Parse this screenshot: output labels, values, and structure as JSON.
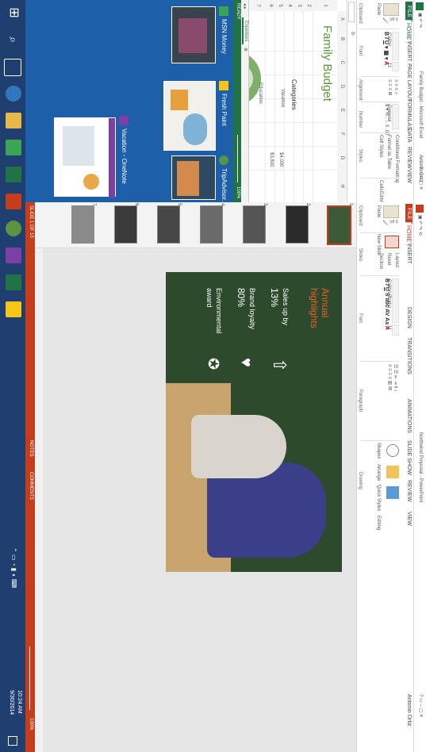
{
  "excel": {
    "title": "Family Budget - Microsoft Excel",
    "tabs": [
      "FILE",
      "HOME",
      "INSERT",
      "PAGE LAYOUT",
      "FORMULAS",
      "DATA",
      "REVIEW",
      "VIEW"
    ],
    "user": "Antonio Ortiz",
    "ribbon": {
      "paste": "Paste",
      "font_name": "Calibri",
      "font_size": "11",
      "number_format": "General",
      "conditional_formatting": "Conditional Formatting",
      "format_as_table": "Format as Table",
      "cell_styles": "Cell Styles",
      "cells": "Cells",
      "editing": "Editing",
      "groups": [
        "Clipboard",
        "Font",
        "Alignment",
        "Number",
        "Styles"
      ]
    },
    "formula_bar": {
      "fx": "fx"
    },
    "columns": [
      "A",
      "B",
      "C",
      "D",
      "E",
      "F",
      "G",
      "H"
    ],
    "rows": [
      "1",
      "2",
      "3",
      "4",
      "5",
      "6",
      "7"
    ],
    "cells": {
      "title": "Family Budget",
      "categories": "Categories",
      "vacation": "Vacation",
      "value1": "$4,000",
      "value2": "$3,800",
      "education": "Education"
    },
    "sheet_tab": "Expenses",
    "status": "READY",
    "zoom": "100%"
  },
  "powerpoint": {
    "title": "Northwind Proposal - PowerPoint",
    "tabs": [
      "FILE",
      "HOME",
      "INSERT",
      "DESIGN",
      "TRANSITIONS",
      "ANIMATIONS",
      "SLIDE SHOW",
      "REVIEW",
      "VIEW"
    ],
    "user": "Antonio Ortiz",
    "ribbon": {
      "paste": "Paste",
      "new_slide": "New Slide",
      "layout": "Layout",
      "reset": "Reset",
      "section": "Section",
      "font_name": "Calibri (Body)",
      "font_size": "11",
      "shapes": "Shapes",
      "arrange": "Arrange",
      "quick_styles": "Quick Styles",
      "editing": "Editing",
      "groups": [
        "Clipboard",
        "Slides",
        "Font",
        "Paragraph",
        "Drawing"
      ]
    },
    "slide_numbers": [
      "1",
      "2",
      "3",
      "4",
      "5",
      "6",
      "7"
    ],
    "slide": {
      "heading_line1": "Annual",
      "heading_line2": "highlights",
      "stat1_label": "Sales up by",
      "stat1_value": "13%",
      "stat2_label": "Brand loyalty",
      "stat2_value": "80%",
      "stat3_label_1": "Environmental",
      "stat3_label_2": "award",
      "icon1": "dollar-icon",
      "icon2": "heart-icon",
      "icon3": "award-icon"
    },
    "status": {
      "slide_of": "SLIDE 1 OF 10",
      "notes": "NOTES",
      "comments": "COMMENTS",
      "zoom": "100%"
    }
  },
  "start": {
    "tiles": [
      {
        "label": "MSN Money",
        "icon": "money-icon"
      },
      {
        "label": "Fresh Paint",
        "icon": "paint-icon"
      },
      {
        "label": "TripAdvisor...",
        "icon": "tripadvisor-icon"
      },
      {
        "label": "Vacation - OneNote",
        "icon": "onenote-icon"
      }
    ]
  },
  "taskbar": {
    "time": "10:24 AM",
    "date": "9/30/2014",
    "apps": [
      "start-icon",
      "search-icon",
      "task-view-icon",
      "ie-icon",
      "file-explorer-icon",
      "store-icon",
      "excel-icon",
      "powerpoint-icon",
      "tripadvisor-icon",
      "onenote-icon",
      "excel-icon",
      "fresh-paint-icon"
    ]
  },
  "colors": {
    "excel_green": "#217346",
    "ppt_red": "#c43e1c",
    "desktop_blue": "#1d5fa8",
    "taskbar": "#1f3f70",
    "slide_accent": "#e5622a"
  }
}
